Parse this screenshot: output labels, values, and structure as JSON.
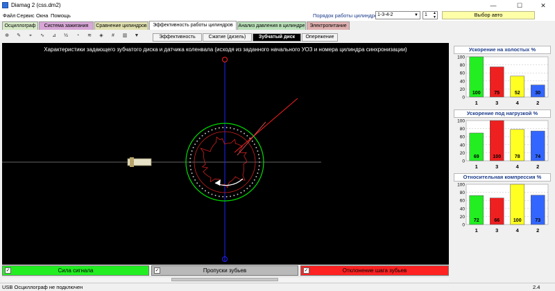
{
  "window": {
    "title": "Diamag 2 (css.dm2)",
    "controls": {
      "minimize": "—",
      "maximize": "☐",
      "close": "✕"
    }
  },
  "menu": {
    "items": [
      "Файл",
      "Сервис",
      "Окна",
      "Помощь"
    ],
    "order_label": "Порядок работы цилиндров",
    "order_value": "1-3-4-2",
    "cylinder_value": "1",
    "auto_button": "Выбор авто"
  },
  "tabs": [
    {
      "label": "Осциллограф",
      "color": "#d6e9c6"
    },
    {
      "label": "Система зажигания",
      "color": "#d7a6d6"
    },
    {
      "label": "Сравнение цилиндров",
      "color": "#e0e0b0"
    },
    {
      "label": "Эффективность работы цилиндров",
      "color": "#ffffff"
    },
    {
      "label": "Анализ давления в цилиндре",
      "color": "#b9e0b9"
    },
    {
      "label": "Электропитание",
      "color": "#e0b0b0"
    }
  ],
  "subtabs": [
    "Эффективность",
    "Сжатие (дизель)",
    "Зубчатый диск",
    "Опережение"
  ],
  "toolbar_icons": [
    "ruler-icon",
    "marker-icon",
    "crosshair-icon",
    "polyline-icon",
    "graph-icon",
    "fraction-icon",
    "rainbow-icon",
    "wave-icon",
    "shield-icon",
    "number-icon",
    "bar-icon",
    "filter-icon"
  ],
  "plot": {
    "title": "Характеристики задающего зубчатого диска и датчика коленвала (исходя из заданного начального УОЗ и номера цилиндра синхронизации)",
    "colors": {
      "background": "#000000",
      "axis": "#888888",
      "vertical_axis": "#2020ff",
      "outer_circle": "#00dd00",
      "pointer": "#ff2020"
    }
  },
  "indicators": [
    {
      "label": "Сила сигнала",
      "color": "#22ee22",
      "text_color": "#000000"
    },
    {
      "label": "Пропуски зубьев",
      "color": "#b9b9b9",
      "text_color": "#000000"
    },
    {
      "label": "Отклонение шага зубьев",
      "color": "#ff2222",
      "text_color": "#000000"
    }
  ],
  "status": {
    "text": "USB Осциллограф не подключен",
    "version": "2.4"
  },
  "panels": [
    {
      "title": "Ускорение на холостых %",
      "yticks": [
        "100",
        "80",
        "60",
        "40",
        "20",
        "0"
      ],
      "bars": [
        {
          "cyl": "1",
          "value": 100,
          "label": "100",
          "color": "#22ee22"
        },
        {
          "cyl": "3",
          "value": 75,
          "label": "75",
          "color": "#ee2020"
        },
        {
          "cyl": "4",
          "value": 52,
          "label": "52",
          "color": "#ffff22"
        },
        {
          "cyl": "2",
          "value": 30,
          "label": "30",
          "color": "#3366ff"
        }
      ]
    },
    {
      "title": "Ускорение под нагрузкой %",
      "yticks": [
        "100",
        "80",
        "60",
        "40",
        "20",
        "0"
      ],
      "bars": [
        {
          "cyl": "1",
          "value": 69,
          "label": "69",
          "color": "#22ee22"
        },
        {
          "cyl": "3",
          "value": 100,
          "label": "100",
          "color": "#ee2020"
        },
        {
          "cyl": "4",
          "value": 78,
          "label": "78",
          "color": "#ffff22"
        },
        {
          "cyl": "2",
          "value": 74,
          "label": "74",
          "color": "#3366ff"
        }
      ]
    },
    {
      "title": "Относительная компрессия %",
      "yticks": [
        "100",
        "80",
        "60",
        "40",
        "20",
        "0"
      ],
      "bars": [
        {
          "cyl": "1",
          "value": 72,
          "label": "72",
          "color": "#22ee22"
        },
        {
          "cyl": "3",
          "value": 66,
          "label": "66",
          "color": "#ee2020"
        },
        {
          "cyl": "4",
          "value": 100,
          "label": "100",
          "color": "#ffff22"
        },
        {
          "cyl": "2",
          "value": 73,
          "label": "73",
          "color": "#3366ff"
        }
      ]
    }
  ]
}
